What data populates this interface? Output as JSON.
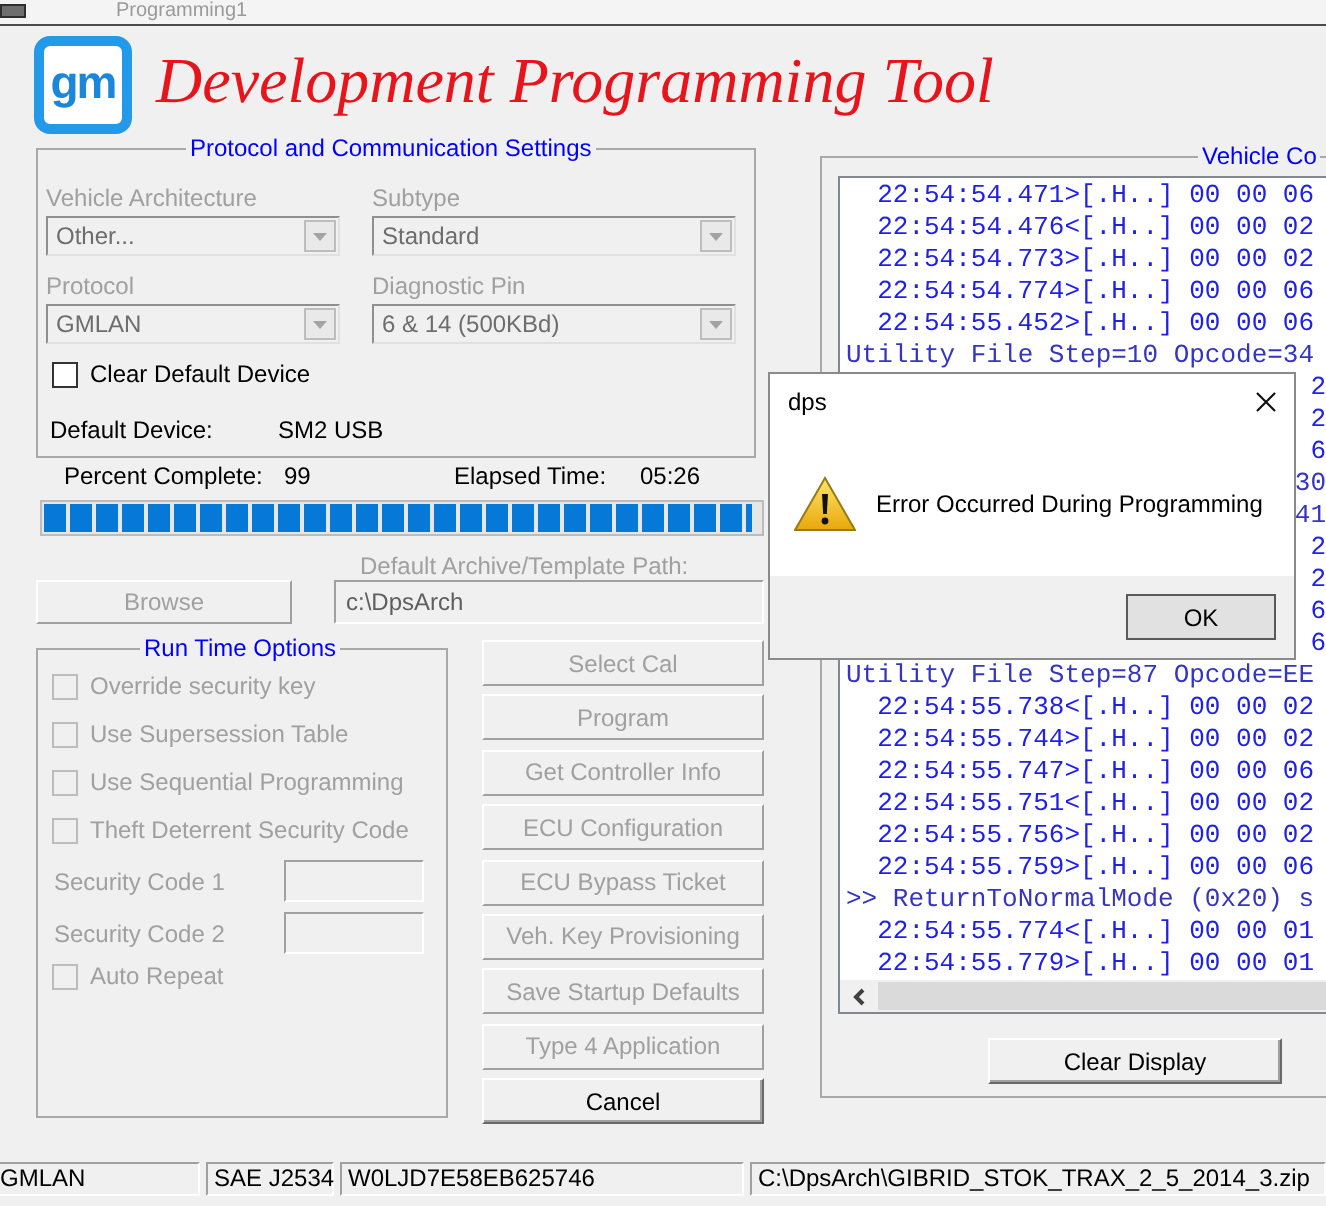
{
  "window": {
    "title": "Programming1"
  },
  "header": {
    "logo_text": "gm",
    "title": "Development Programming Tool"
  },
  "protocol_settings": {
    "title": "Protocol and Communication Settings",
    "dropdowns": [
      {
        "label": "Vehicle Architecture",
        "value": "Other...",
        "disabled": true
      },
      {
        "label": "Subtype",
        "value": "Standard",
        "disabled": true
      },
      {
        "label": "Protocol",
        "value": "GMLAN",
        "disabled": true
      },
      {
        "label": "Diagnostic Pin",
        "value": "6 & 14 (500KBd)",
        "disabled": true
      }
    ],
    "clear_default_device": {
      "label": "Clear Default Device",
      "checked": false,
      "disabled": false
    },
    "default_device": {
      "label": "Default Device:",
      "value": "SM2 USB"
    }
  },
  "progress": {
    "percent_label": "Percent Complete:",
    "percent": "99",
    "elapsed_label": "Elapsed Time:",
    "elapsed": "05:26",
    "level": 0.99
  },
  "archive": {
    "label": "Default Archive/Template Path:",
    "browse_button": {
      "label": "Browse",
      "disabled": true
    },
    "path_field": {
      "value": "c:\\DpsArch",
      "disabled": true
    }
  },
  "run_time_options": {
    "title": "Run Time Options",
    "items": [
      {
        "kind": "checkbox",
        "label": "Override security key",
        "checked": false,
        "disabled": true
      },
      {
        "kind": "checkbox",
        "label": "Use Supersession Table",
        "checked": false,
        "disabled": true
      },
      {
        "kind": "checkbox",
        "label": "Use Sequential Programming",
        "checked": false,
        "disabled": true
      },
      {
        "kind": "checkbox",
        "label": "Theft Deterrent Security Code",
        "checked": false,
        "disabled": true
      },
      {
        "kind": "field",
        "label": "Security Code 1",
        "disabled": true
      },
      {
        "kind": "field",
        "label": "Security Code 2",
        "disabled": true
      },
      {
        "kind": "checkbox",
        "label": "Auto Repeat",
        "checked": false,
        "disabled": true
      }
    ]
  },
  "actions": [
    {
      "label": "Select Cal",
      "disabled": true
    },
    {
      "label": "Program",
      "disabled": true
    },
    {
      "label": "Get Controller Info",
      "disabled": true
    },
    {
      "label": "ECU Configuration",
      "disabled": true
    },
    {
      "label": "ECU Bypass Ticket",
      "disabled": true
    },
    {
      "label": "Veh. Key Provisioning",
      "disabled": true
    },
    {
      "label": "Save Startup Defaults",
      "disabled": true
    },
    {
      "label": "Type 4 Application",
      "disabled": true
    },
    {
      "label": "Cancel",
      "disabled": false
    }
  ],
  "vehicle_panel": {
    "title": "Vehicle Co",
    "log": [
      {
        "kind": "frame",
        "text": "22:54:54.471>[.H..] 00 00 06"
      },
      {
        "kind": "frame",
        "text": "22:54:54.476<[.H..] 00 00 02"
      },
      {
        "kind": "frame",
        "text": "22:54:54.773>[.H..] 00 00 02"
      },
      {
        "kind": "frame",
        "text": "22:54:54.774>[.H..] 00 00 06"
      },
      {
        "kind": "frame",
        "text": "22:54:55.452>[.H..] 00 00 06"
      },
      {
        "kind": "step",
        "text": "Utility File Step=10 Opcode=34"
      },
      {
        "kind": "frame_tail",
        "text": "2"
      },
      {
        "kind": "frame_tail",
        "text": "2"
      },
      {
        "kind": "frame_tail",
        "text": "6"
      },
      {
        "kind": "step_tail",
        "text": "30"
      },
      {
        "kind": "step_tail",
        "text": "41"
      },
      {
        "kind": "frame_tail",
        "text": "2"
      },
      {
        "kind": "frame_tail",
        "text": "2"
      },
      {
        "kind": "frame_tail",
        "text": "6"
      },
      {
        "kind": "frame_tail",
        "text": "6"
      },
      {
        "kind": "step",
        "text": "Utility File Step=87 Opcode=EE"
      },
      {
        "kind": "frame",
        "text": "22:54:55.738<[.H..] 00 00 02"
      },
      {
        "kind": "frame",
        "text": "22:54:55.744>[.H..] 00 00 02"
      },
      {
        "kind": "frame",
        "text": "22:54:55.747>[.H..] 00 00 06"
      },
      {
        "kind": "frame",
        "text": "22:54:55.751<[.H..] 00 00 02"
      },
      {
        "kind": "frame",
        "text": "22:54:55.756>[.H..] 00 00 02"
      },
      {
        "kind": "frame",
        "text": "22:54:55.759>[.H..] 00 00 06"
      },
      {
        "kind": "step",
        "text": ">> ReturnToNormalMode (0x20) s"
      },
      {
        "kind": "frame",
        "text": "22:54:55.774<[.H..] 00 00 01"
      },
      {
        "kind": "frame",
        "text": "22:54:55.779>[.H..] 00 00 01"
      }
    ],
    "clear_button": {
      "label": "Clear Display",
      "disabled": false
    }
  },
  "dialog": {
    "title": "dps",
    "message": "Error Occurred During Programming",
    "ok_button": "OK"
  },
  "status_bar": [
    "GMLAN",
    "SAE J2534",
    "W0LJD7E58EB625746",
    "C:\\DpsArch\\GIBRID_STOK_TRAX_2_5_2014_3.zip"
  ]
}
